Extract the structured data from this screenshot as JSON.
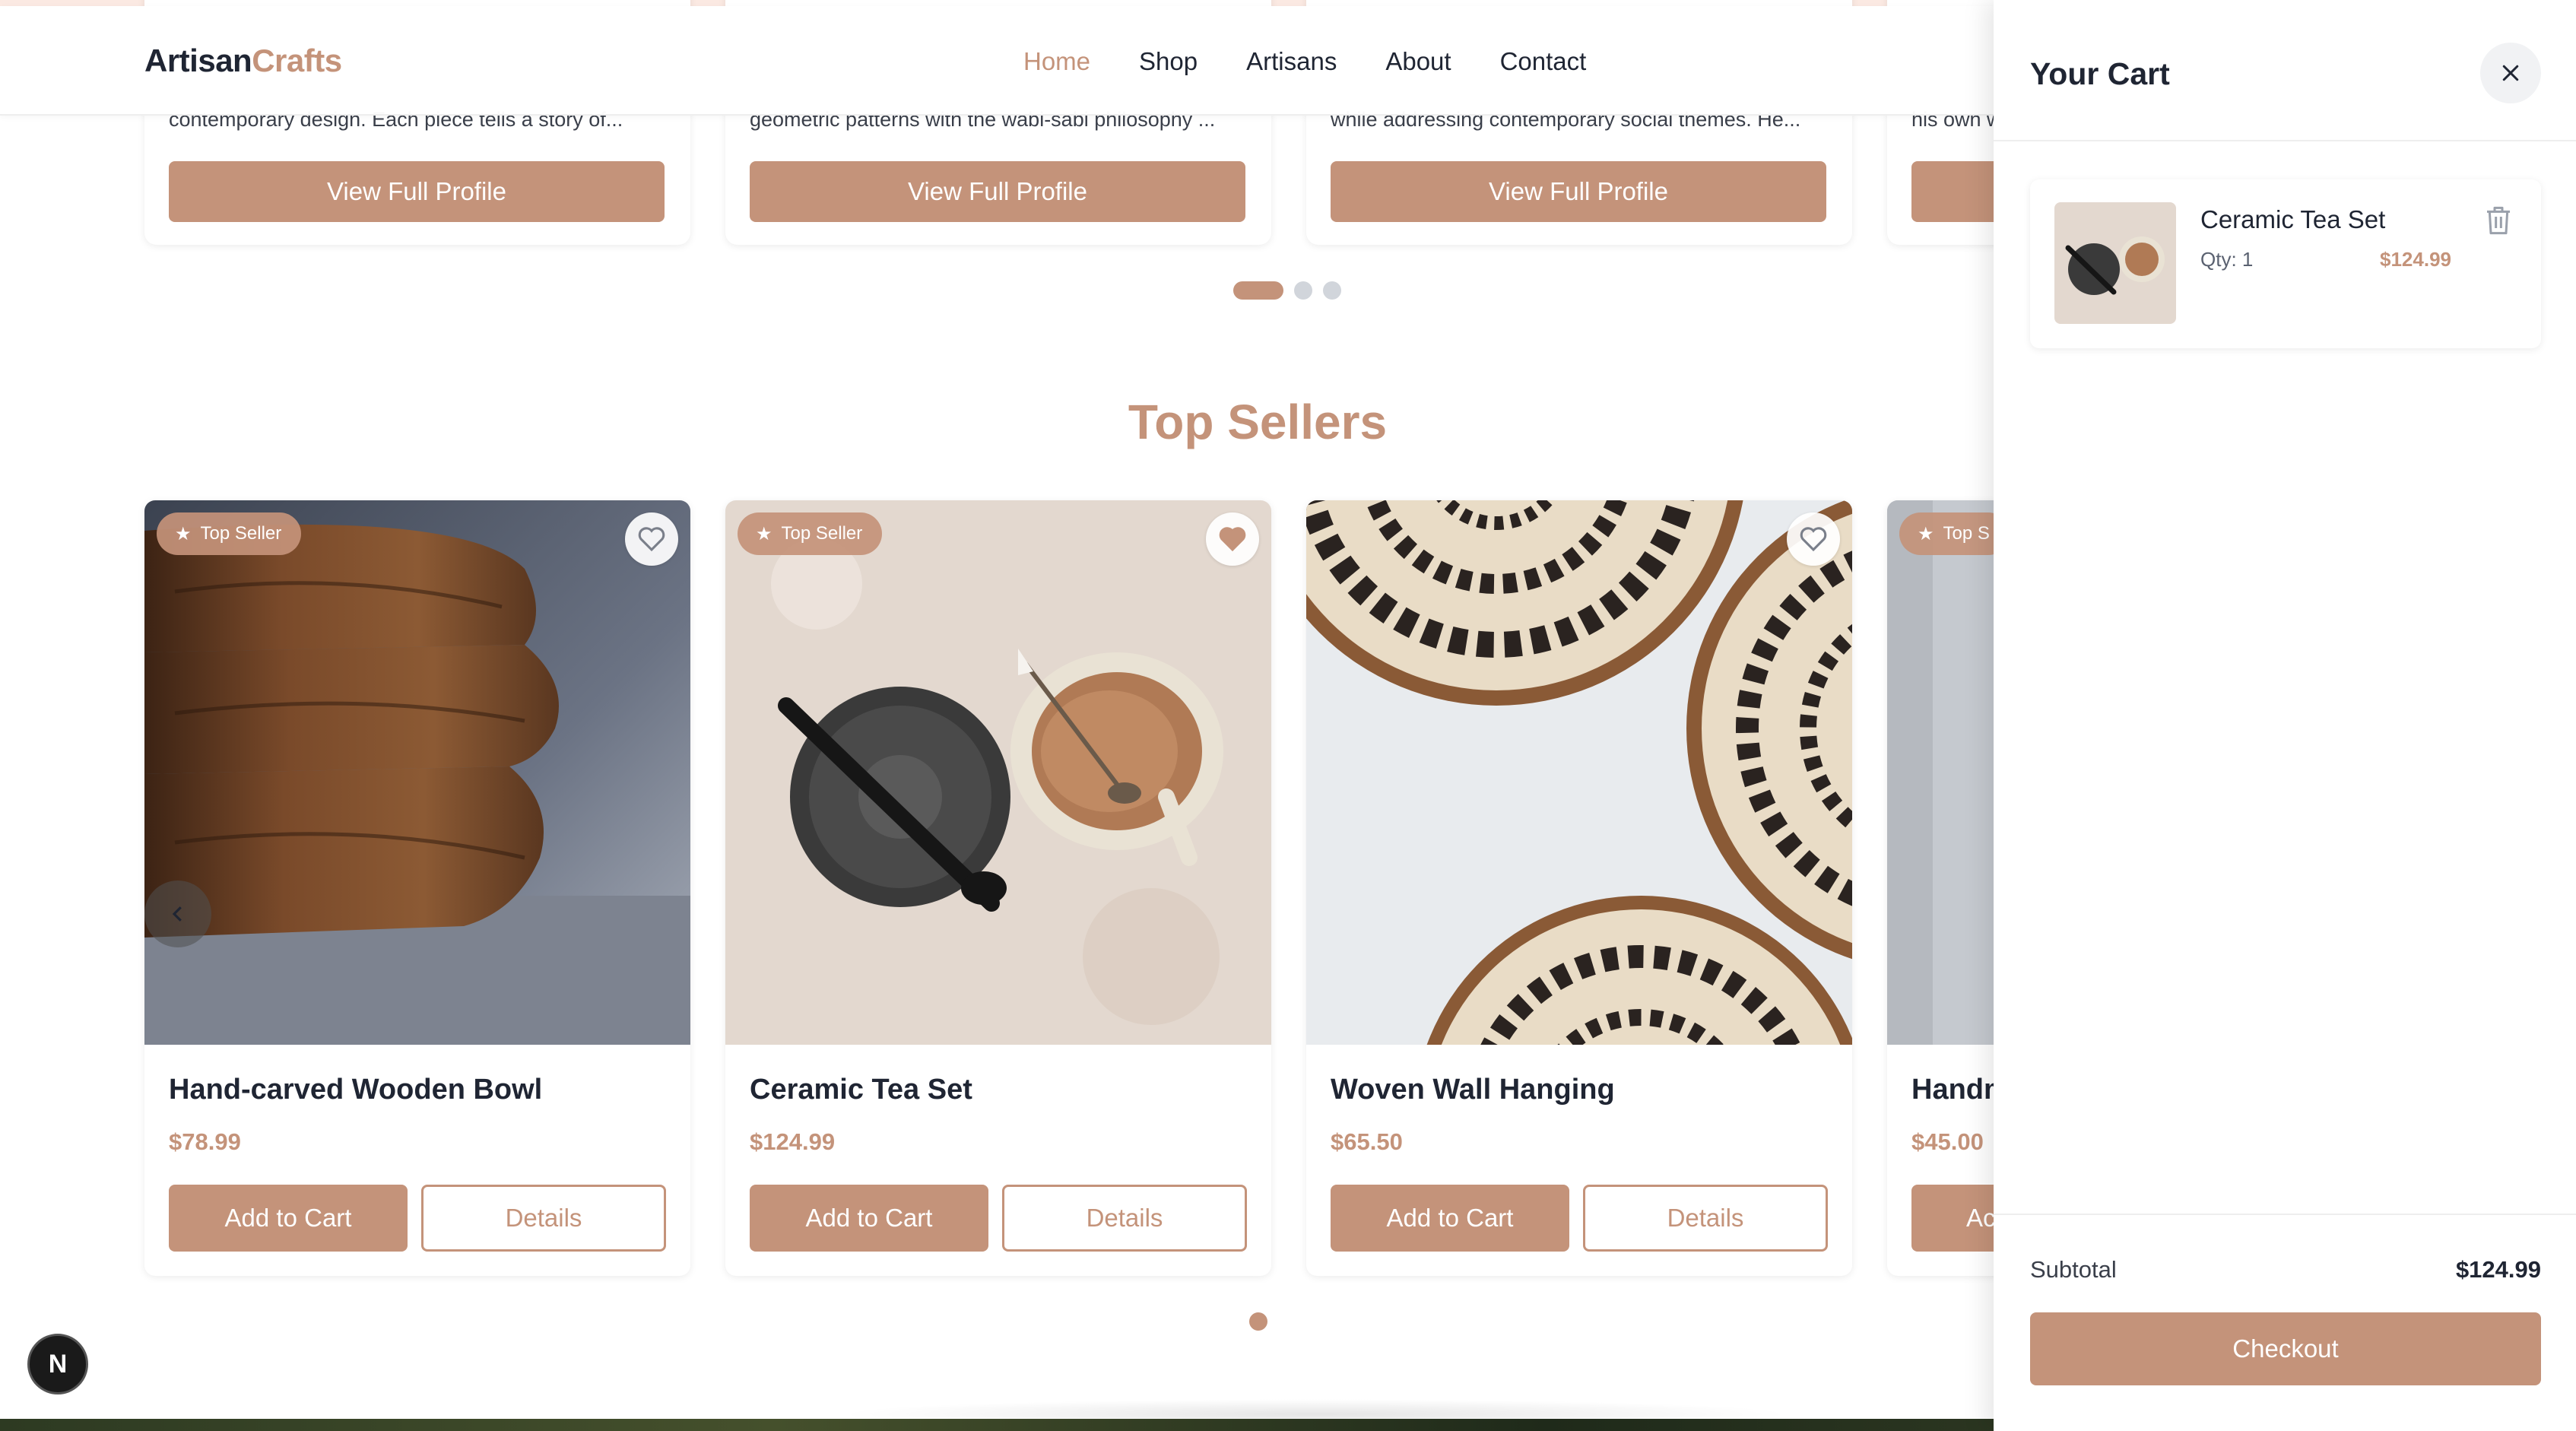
{
  "header": {
    "logo_part1": "Artisan",
    "logo_part2": "Crafts",
    "nav": [
      "Home",
      "Shop",
      "Artisans",
      "About",
      "Contact"
    ],
    "active_nav": "Home"
  },
  "artisans": {
    "cards": [
      {
        "description": "contemporary design. Each piece tells a story of...",
        "button": "View Full Profile"
      },
      {
        "description": "geometric patterns with the wabi-sabi philosophy ...",
        "button": "View Full Profile"
      },
      {
        "description": "while addressing contemporary social themes. He...",
        "button": "View Full Profile"
      },
      {
        "description": "his own w",
        "button": "View Full Profile"
      }
    ],
    "dots_total": 3,
    "dots_active": 1
  },
  "top_sellers": {
    "title": "Top Sellers",
    "badge_label": "Top Seller",
    "badge_label_partial": "Top S",
    "products": [
      {
        "name": "Hand-carved Wooden Bowl",
        "price": "$78.99",
        "add": "Add to Cart",
        "details": "Details",
        "favorited": false,
        "has_badge": true
      },
      {
        "name": "Ceramic Tea Set",
        "price": "$124.99",
        "add": "Add to Cart",
        "details": "Details",
        "favorited": true,
        "has_badge": true
      },
      {
        "name": "Woven Wall Hanging",
        "price": "$65.50",
        "add": "Add to Cart",
        "details": "Details",
        "favorited": false,
        "has_badge": false
      },
      {
        "name": "Handm",
        "price": "$45.00",
        "add": "Ac",
        "details": "",
        "favorited": false,
        "has_badge": true
      }
    ]
  },
  "cart": {
    "title": "Your Cart",
    "items": [
      {
        "name": "Ceramic Tea Set",
        "qty_label": "Qty: 1",
        "price": "$124.99"
      }
    ],
    "subtotal_label": "Subtotal",
    "subtotal_value": "$124.99",
    "checkout_label": "Checkout"
  },
  "dev_badge": "N",
  "colors": {
    "accent": "#c4937a",
    "text": "#1f2533",
    "dot_inactive": "#d1d5db"
  },
  "icons": [
    "star-icon",
    "heart-icon",
    "chevron-left-icon",
    "close-icon",
    "trash-icon"
  ]
}
